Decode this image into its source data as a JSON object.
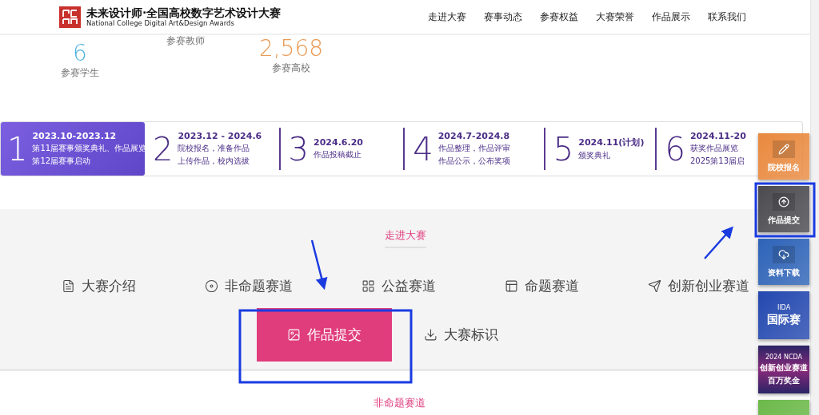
{
  "header": {
    "logo_title": "未来设计师·全国高校数字艺术设计大赛",
    "logo_subtitle": "National College Digital Art&Design Awards",
    "nav": [
      {
        "label": "走进大赛"
      },
      {
        "label": "赛事动态"
      },
      {
        "label": "参赛权益"
      },
      {
        "label": "大赛荣誉"
      },
      {
        "label": "作品展示"
      },
      {
        "label": "联系我们"
      }
    ]
  },
  "stats": [
    {
      "value": "6",
      "label": "参赛学生",
      "color": "#4fb3de"
    },
    {
      "label": "参赛教师"
    },
    {
      "value": "2,568",
      "label": "参赛高校",
      "color": "#e89a55"
    }
  ],
  "timeline": [
    {
      "number": "1",
      "date": "2023.10-2023.12",
      "lines": [
        "第11届赛事颁奖典礼、作品展览",
        "第12届赛事启动"
      ],
      "selected": true
    },
    {
      "number": "2",
      "date": "2023.12 - 2024.6",
      "lines": [
        "院校报名，准备作品",
        "上传作品，校内选拔"
      ],
      "selected": false
    },
    {
      "number": "3",
      "date": "2024.6.20",
      "lines": [
        "作品投稿截止"
      ],
      "selected": false
    },
    {
      "number": "4",
      "date": "2024.7-2024.8",
      "lines": [
        "作品整理，作品评审",
        "作品公示，公布奖项"
      ],
      "selected": false
    },
    {
      "number": "5",
      "date": "2024.11(计划)",
      "lines": [
        "颁奖典礼"
      ],
      "selected": false
    },
    {
      "number": "6",
      "date": "2024.11-20",
      "lines": [
        "获奖作品展览",
        "2025第13届启"
      ],
      "selected": false
    }
  ],
  "section": {
    "title": "走进大赛",
    "tabs": [
      {
        "label": "大赛介绍",
        "selected": false
      },
      {
        "label": "非命题赛道",
        "selected": false
      },
      {
        "label": "公益赛道",
        "selected": false
      },
      {
        "label": "命题赛道",
        "selected": false
      },
      {
        "label": "创新创业赛道",
        "selected": false
      },
      {
        "label": "作品提交",
        "selected": true
      },
      {
        "label": "大赛标识",
        "selected": false
      }
    ]
  },
  "next_section_title": "非命题赛道",
  "side_bar": [
    {
      "kind": "icon",
      "label": "院校报名",
      "color": "#e9893e"
    },
    {
      "kind": "icon",
      "label": "作品提交",
      "color": "#4a4a4f"
    },
    {
      "kind": "icon",
      "label": "资料下载",
      "color": "#2d63b8"
    },
    {
      "kind": "banner",
      "top": "IIDA",
      "label": "国际赛",
      "color": "#2348b0"
    },
    {
      "kind": "banner",
      "top": "2024 NCDA",
      "label": "创新创业赛道",
      "bottom": "百万奖金",
      "color": "#2a2466"
    },
    {
      "kind": "partial",
      "color": "#6cb94a"
    }
  ]
}
